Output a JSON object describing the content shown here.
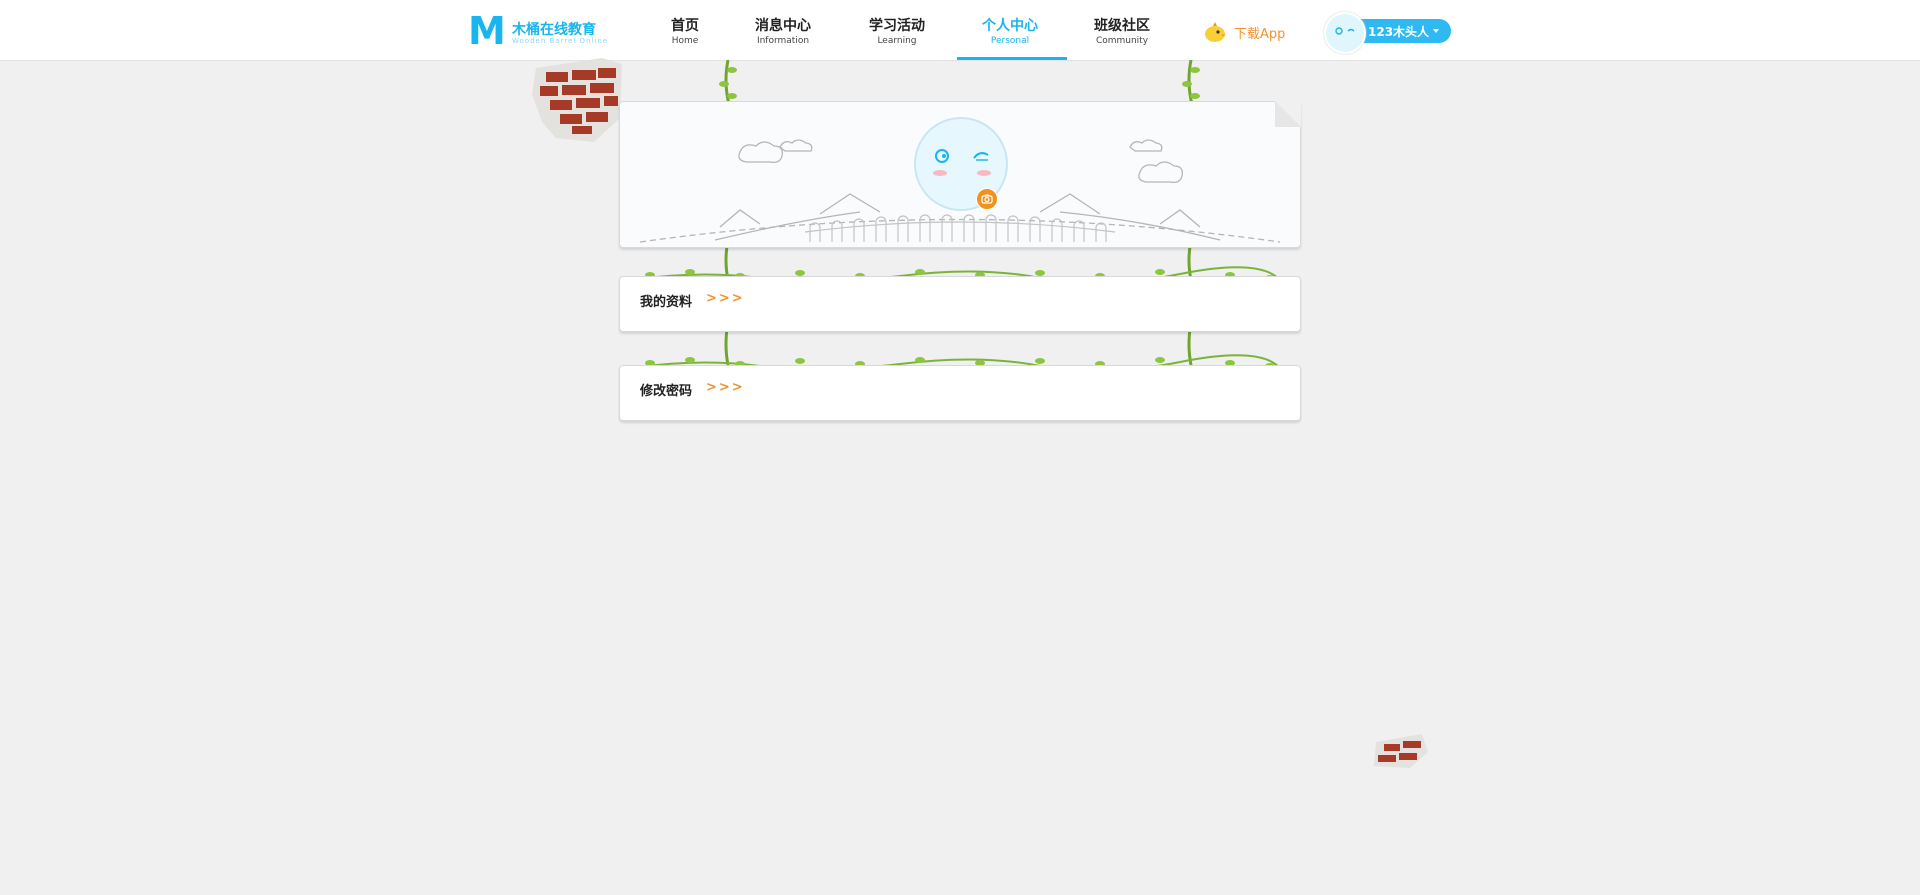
{
  "logo": {
    "mark": "M",
    "name_cn": "木桶在线教育",
    "name_en": "Wooden Barrel Online"
  },
  "nav": [
    {
      "label_cn": "首页",
      "label_en": "Home",
      "active": false
    },
    {
      "label_cn": "消息中心",
      "label_en": "Information",
      "active": false
    },
    {
      "label_cn": "学习活动",
      "label_en": "Learning",
      "active": false
    },
    {
      "label_cn": "个人中心",
      "label_en": "Personal",
      "active": true
    },
    {
      "label_cn": "班级社区",
      "label_en": "Community",
      "active": false
    }
  ],
  "download": {
    "label": "下载App",
    "icon": "chick-icon"
  },
  "user": {
    "name": "123木头人",
    "icon": "avatar-face-icon"
  },
  "profile": {
    "avatar_icon": "winking-face-icon",
    "camera_icon": "camera-icon"
  },
  "sections": [
    {
      "label": "我的资料",
      "arrows": ">>>"
    },
    {
      "label": "修改密码",
      "arrows": ">>>"
    }
  ],
  "colors": {
    "accent": "#19b5ee",
    "orange": "#f2922f",
    "vine": "#7bb33a",
    "background": "#f0f0f0"
  }
}
